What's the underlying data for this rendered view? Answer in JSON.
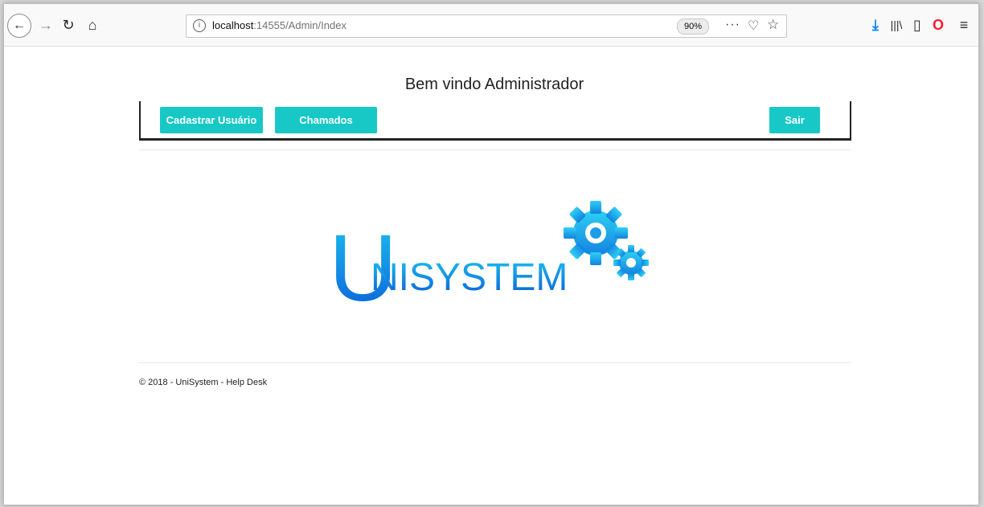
{
  "browser": {
    "url_prefix": "localhost",
    "url_rest": ":14555/Admin/Index",
    "zoom": "90%",
    "icons": {
      "back": "back-arrow-icon",
      "forward": "forward-arrow-icon",
      "reload": "reload-icon",
      "home": "home-icon",
      "info": "info-icon",
      "more": "more-actions-icon",
      "pocket": "pocket-icon",
      "bookmark": "star-icon",
      "download": "download-icon",
      "library": "library-icon",
      "sidebar": "sidebar-icon",
      "opera": "opera-icon",
      "menu": "hamburger-menu-icon"
    }
  },
  "page": {
    "welcome": "Bem vindo Administrador",
    "nav": {
      "register_user": "Cadastrar Usuário",
      "tickets": "Chamados",
      "logout": "Sair"
    },
    "logo_text": "NISYSTEM",
    "logo_initial": "U",
    "footer": "© 2018 - UniSystem - Help Desk"
  },
  "colors": {
    "button": "#17c8c6",
    "logo_gradient_top": "#1ec3f0",
    "logo_gradient_bottom": "#0a5bd8"
  }
}
